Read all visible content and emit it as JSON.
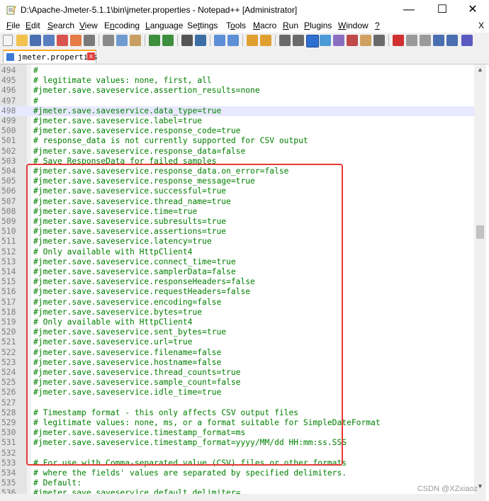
{
  "window": {
    "title": "D:\\Apache-Jmeter-5.1.1\\bin\\jmeter.properties - Notepad++ [Administrator]",
    "minimize": "—",
    "maximize": "☐",
    "close": "✕"
  },
  "menu": {
    "items": [
      {
        "u": "F",
        "rest": "ile"
      },
      {
        "u": "E",
        "rest": "dit"
      },
      {
        "u": "S",
        "rest": "earch"
      },
      {
        "u": "V",
        "rest": "iew"
      },
      {
        "u": "",
        "pre": "E",
        "u2": "n",
        "rest": "coding"
      },
      {
        "u": "L",
        "rest": "anguage"
      },
      {
        "u": "",
        "pre": "Se",
        "u2": "t",
        "rest": "tings"
      },
      {
        "u": "",
        "pre": "T",
        "u2": "o",
        "rest": "ols"
      },
      {
        "u": "M",
        "rest": "acro"
      },
      {
        "u": "R",
        "rest": "un"
      },
      {
        "u": "P",
        "rest": "lugins"
      },
      {
        "u": "W",
        "rest": "indow"
      },
      {
        "u": "?",
        "rest": ""
      }
    ],
    "close_label": "X"
  },
  "tab": {
    "label": "jmeter.properties",
    "close": "x"
  },
  "editor": {
    "current_line": 498,
    "lines": [
      {
        "n": "494",
        "t": "#"
      },
      {
        "n": "495",
        "t": "# legitimate values: none, first, all"
      },
      {
        "n": "496",
        "t": "#jmeter.save.saveservice.assertion_results=none"
      },
      {
        "n": "497",
        "t": "#"
      },
      {
        "n": "498",
        "t": "#jmeter.save.saveservice.data_type=true"
      },
      {
        "n": "499",
        "t": "#jmeter.save.saveservice.label=true"
      },
      {
        "n": "500",
        "t": "#jmeter.save.saveservice.response_code=true"
      },
      {
        "n": "501",
        "t": "# response_data is not currently supported for CSV output"
      },
      {
        "n": "502",
        "t": "#jmeter.save.saveservice.response_data=false"
      },
      {
        "n": "503",
        "t": "# Save ResponseData for failed samples"
      },
      {
        "n": "504",
        "t": "#jmeter.save.saveservice.response_data.on_error=false"
      },
      {
        "n": "505",
        "t": "#jmeter.save.saveservice.response_message=true"
      },
      {
        "n": "506",
        "t": "#jmeter.save.saveservice.successful=true"
      },
      {
        "n": "507",
        "t": "#jmeter.save.saveservice.thread_name=true"
      },
      {
        "n": "508",
        "t": "#jmeter.save.saveservice.time=true"
      },
      {
        "n": "509",
        "t": "#jmeter.save.saveservice.subresults=true"
      },
      {
        "n": "510",
        "t": "#jmeter.save.saveservice.assertions=true"
      },
      {
        "n": "511",
        "t": "#jmeter.save.saveservice.latency=true"
      },
      {
        "n": "512",
        "t": "# Only available with HttpClient4"
      },
      {
        "n": "513",
        "t": "#jmeter.save.saveservice.connect_time=true"
      },
      {
        "n": "514",
        "t": "#jmeter.save.saveservice.samplerData=false"
      },
      {
        "n": "515",
        "t": "#jmeter.save.saveservice.responseHeaders=false"
      },
      {
        "n": "516",
        "t": "#jmeter.save.saveservice.requestHeaders=false"
      },
      {
        "n": "517",
        "t": "#jmeter.save.saveservice.encoding=false"
      },
      {
        "n": "518",
        "t": "#jmeter.save.saveservice.bytes=true"
      },
      {
        "n": "519",
        "t": "# Only available with HttpClient4"
      },
      {
        "n": "520",
        "t": "#jmeter.save.saveservice.sent_bytes=true"
      },
      {
        "n": "521",
        "t": "#jmeter.save.saveservice.url=true"
      },
      {
        "n": "522",
        "t": "#jmeter.save.saveservice.filename=false"
      },
      {
        "n": "523",
        "t": "#jmeter.save.saveservice.hostname=false"
      },
      {
        "n": "524",
        "t": "#jmeter.save.saveservice.thread_counts=true"
      },
      {
        "n": "525",
        "t": "#jmeter.save.saveservice.sample_count=false"
      },
      {
        "n": "526",
        "t": "#jmeter.save.saveservice.idle_time=true"
      },
      {
        "n": "527",
        "t": ""
      },
      {
        "n": "528",
        "t": "# Timestamp format - this only affects CSV output files"
      },
      {
        "n": "529",
        "t": "# legitimate values: none, ms, or a format suitable for SimpleDateFormat"
      },
      {
        "n": "530",
        "t": "#jmeter.save.saveservice.timestamp_format=ms"
      },
      {
        "n": "531",
        "t": "#jmeter.save.saveservice.timestamp_format=yyyy/MM/dd HH:mm:ss.SSS"
      },
      {
        "n": "532",
        "t": ""
      },
      {
        "n": "533",
        "t": "# For use with Comma-separated value (CSV) files or other formats"
      },
      {
        "n": "534",
        "t": "# where the fields' values are separated by specified delimiters."
      },
      {
        "n": "535",
        "t": "# Default:"
      },
      {
        "n": "536",
        "t": "#jmeter.save.saveservice.default_delimiter="
      }
    ]
  },
  "scroll": {
    "up": "▲",
    "down": "▼",
    "left": "◀",
    "right": "▶"
  },
  "watermark": "CSDN @XZxiaoz",
  "colors": {
    "comment": "#008000",
    "line_number": "#808080",
    "annotation_box": "#e53935",
    "current_line": "#e8e8ff"
  }
}
